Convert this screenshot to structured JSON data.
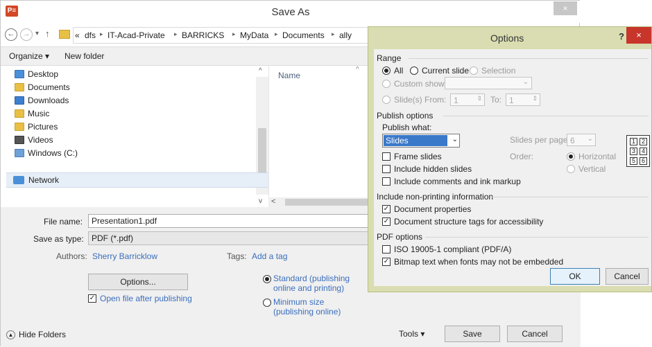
{
  "save_as": {
    "title": "Save As",
    "app_logo": "P≡",
    "close": "×",
    "nav": {
      "back": "←",
      "forward": "→",
      "dropdown": "▾",
      "up": "↑"
    },
    "breadcrumb": [
      "«",
      "dfs",
      "IT-Acad-Private",
      "BARRICKS",
      "MyData",
      "Documents",
      "ally"
    ],
    "toolbar": {
      "organize": "Organize ▾",
      "new_folder": "New folder"
    },
    "nav_items": [
      "Desktop",
      "Documents",
      "Downloads",
      "Music",
      "Pictures",
      "Videos",
      "Windows (C:)"
    ],
    "network": "Network",
    "column_name": "Name",
    "file_name_label": "File name:",
    "file_name_value": "Presentation1.pdf",
    "save_type_label": "Save as type:",
    "save_type_value": "PDF (*.pdf)",
    "authors_label": "Authors:",
    "authors_value": "Sherry Barricklow",
    "tags_label": "Tags:",
    "tags_value": "Add a tag",
    "options_button": "Options...",
    "open_after": "Open file after publishing",
    "standard_line1": "Standard (publishing",
    "standard_line2": "online and printing)",
    "minimum_line1": "Minimum size",
    "minimum_line2": "(publishing online)",
    "hide_folders": "Hide Folders",
    "tools": "Tools ▾",
    "save": "Save",
    "cancel": "Cancel"
  },
  "options": {
    "title": "Options",
    "help": "?",
    "close": "×",
    "range_label": "Range",
    "range_all": "All",
    "range_current": "Current slide",
    "range_selection": "Selection",
    "custom_show": "Custom show:",
    "slides": "Slide(s)",
    "from_label": "From:",
    "from_value": "1",
    "to_label": "To:",
    "to_value": "1",
    "publish_options": "Publish options",
    "publish_what": "Publish what:",
    "publish_value": "Slides",
    "frame_slides": "Frame slides",
    "include_hidden": "Include hidden slides",
    "include_comments": "Include comments and ink markup",
    "slides_per_page": "Slides per page:",
    "slides_per_page_value": "6",
    "order": "Order:",
    "horizontal": "Horizontal",
    "vertical": "Vertical",
    "layout_numbers": [
      "1",
      "2",
      "3",
      "4",
      "5",
      "6"
    ],
    "non_printing": "Include non-printing information",
    "doc_properties": "Document properties",
    "doc_structure": "Document structure tags for accessibility",
    "pdf_options": "PDF options",
    "iso": "ISO 19005-1 compliant (PDF/A)",
    "bitmap": "Bitmap text when fonts may not be embedded",
    "ok": "OK",
    "cancel": "Cancel"
  },
  "colors": {
    "accent_link": "#3a6ebc",
    "options_frame": "#d9ddb1",
    "close_red": "#c7352b"
  }
}
